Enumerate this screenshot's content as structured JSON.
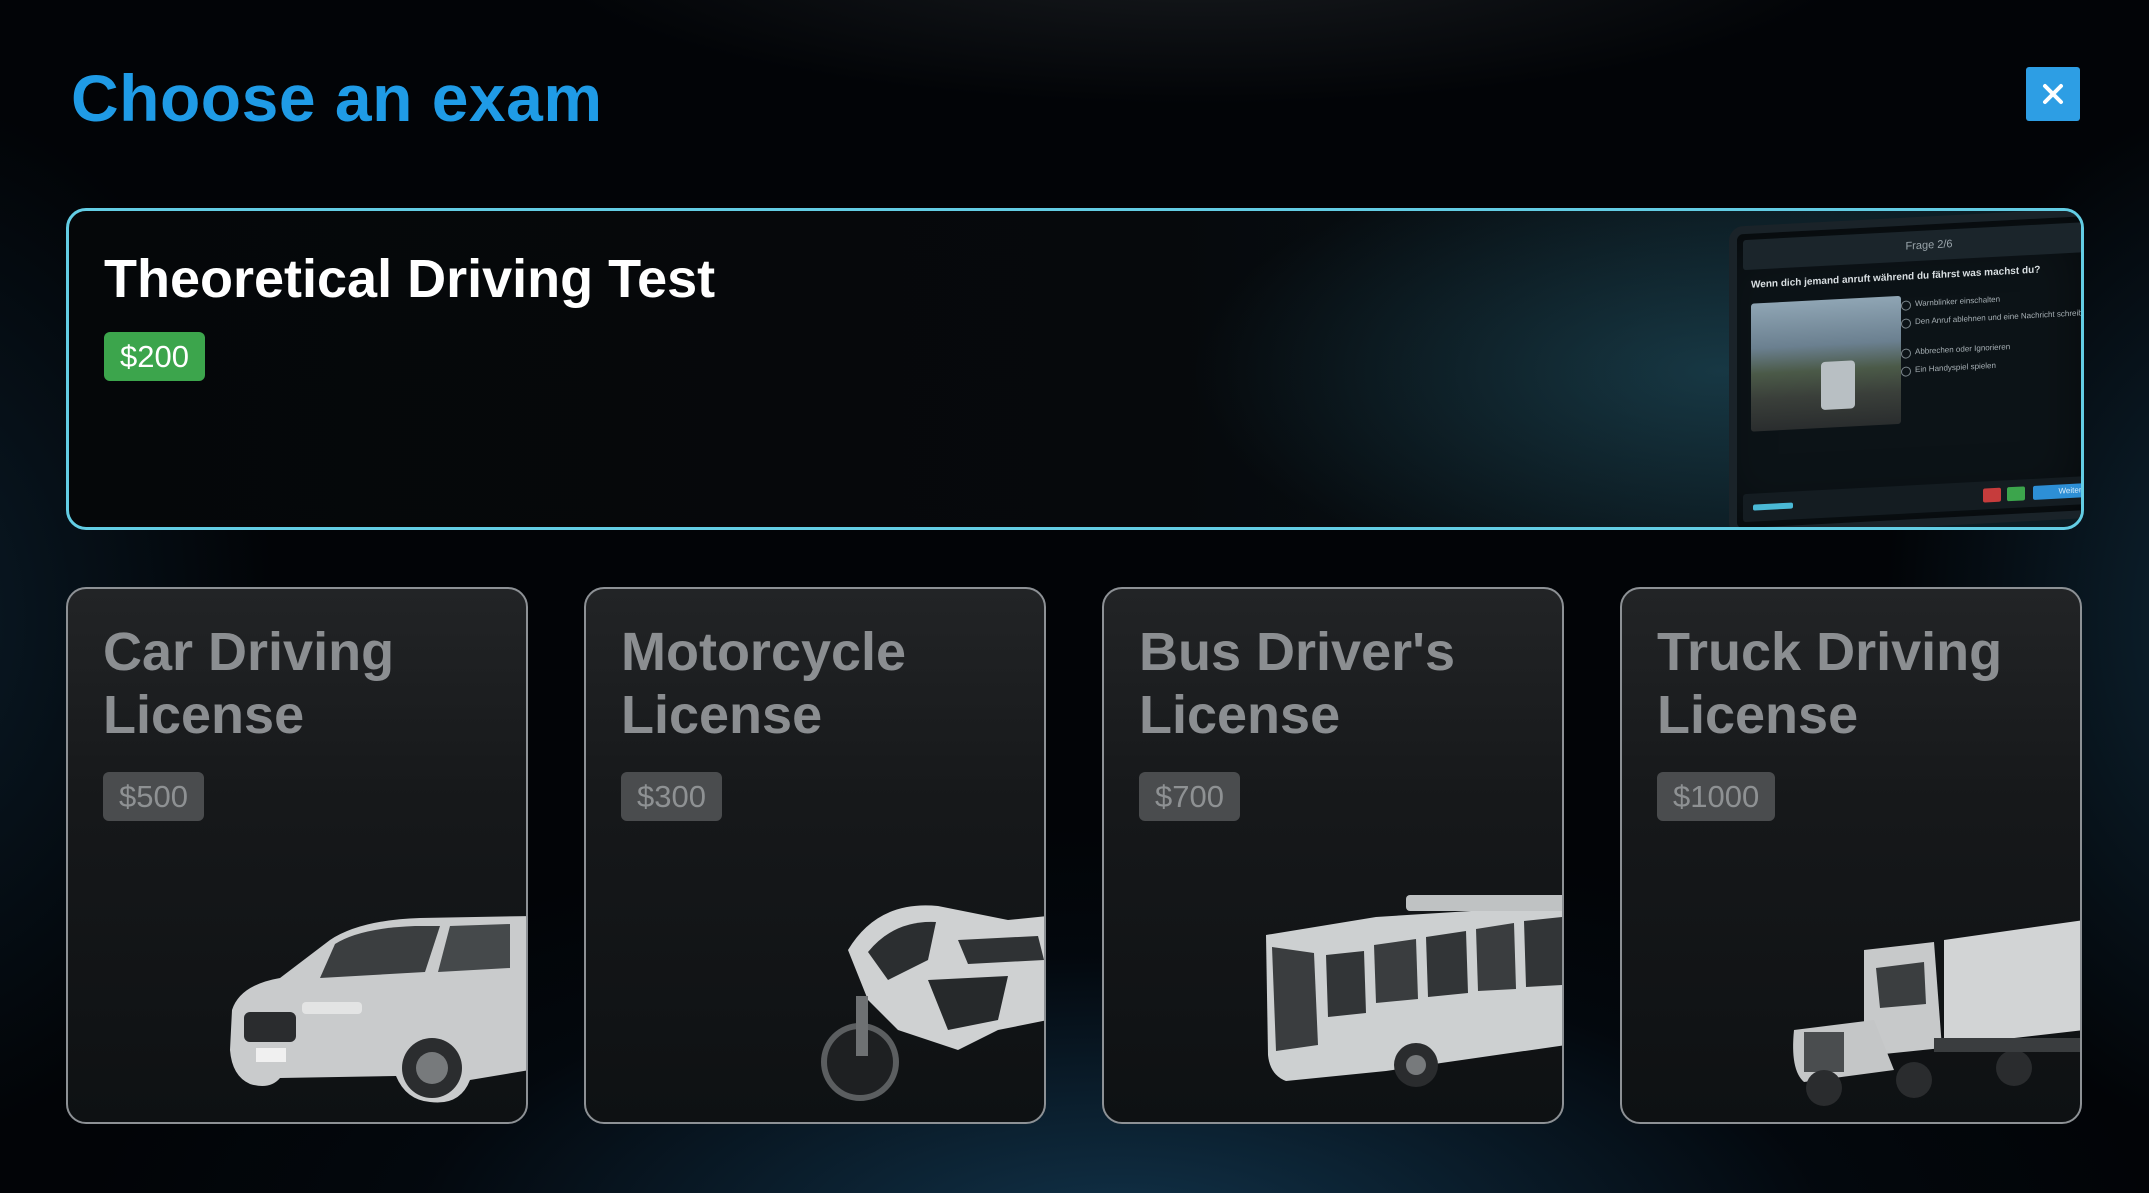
{
  "header": {
    "title": "Choose an exam",
    "close_icon": "close-icon"
  },
  "featured": {
    "title": "Theoretical Driving Test",
    "price": "$200",
    "image_icon": "tablet-quiz-illustration",
    "tablet_header": "Frage 2/6",
    "tablet_question": "Wenn dich jemand anruft während du fährst was machst du?",
    "tablet_options": [
      "Warnblinker einschalten",
      "Den Anruf ablehnen und eine Nachricht schreiben",
      "Abbrechen oder Ignorieren",
      "Ein Handyspiel spielen"
    ],
    "tablet_next": "Weiter"
  },
  "cards": [
    {
      "title": "Car Driving License",
      "price": "$500",
      "icon": "car-icon"
    },
    {
      "title": "Motorcycle License",
      "price": "$300",
      "icon": "motorcycle-icon"
    },
    {
      "title": "Bus Driver's License",
      "price": "$700",
      "icon": "bus-icon"
    },
    {
      "title": "Truck Driving License",
      "price": "$1000",
      "icon": "truck-icon"
    }
  ],
  "colors": {
    "accent": "#1f9be6",
    "featured_border": "#63cde4",
    "price_active": "#3ca54c",
    "price_disabled": "#4a4c4e",
    "close_button": "#2d9ee4"
  }
}
